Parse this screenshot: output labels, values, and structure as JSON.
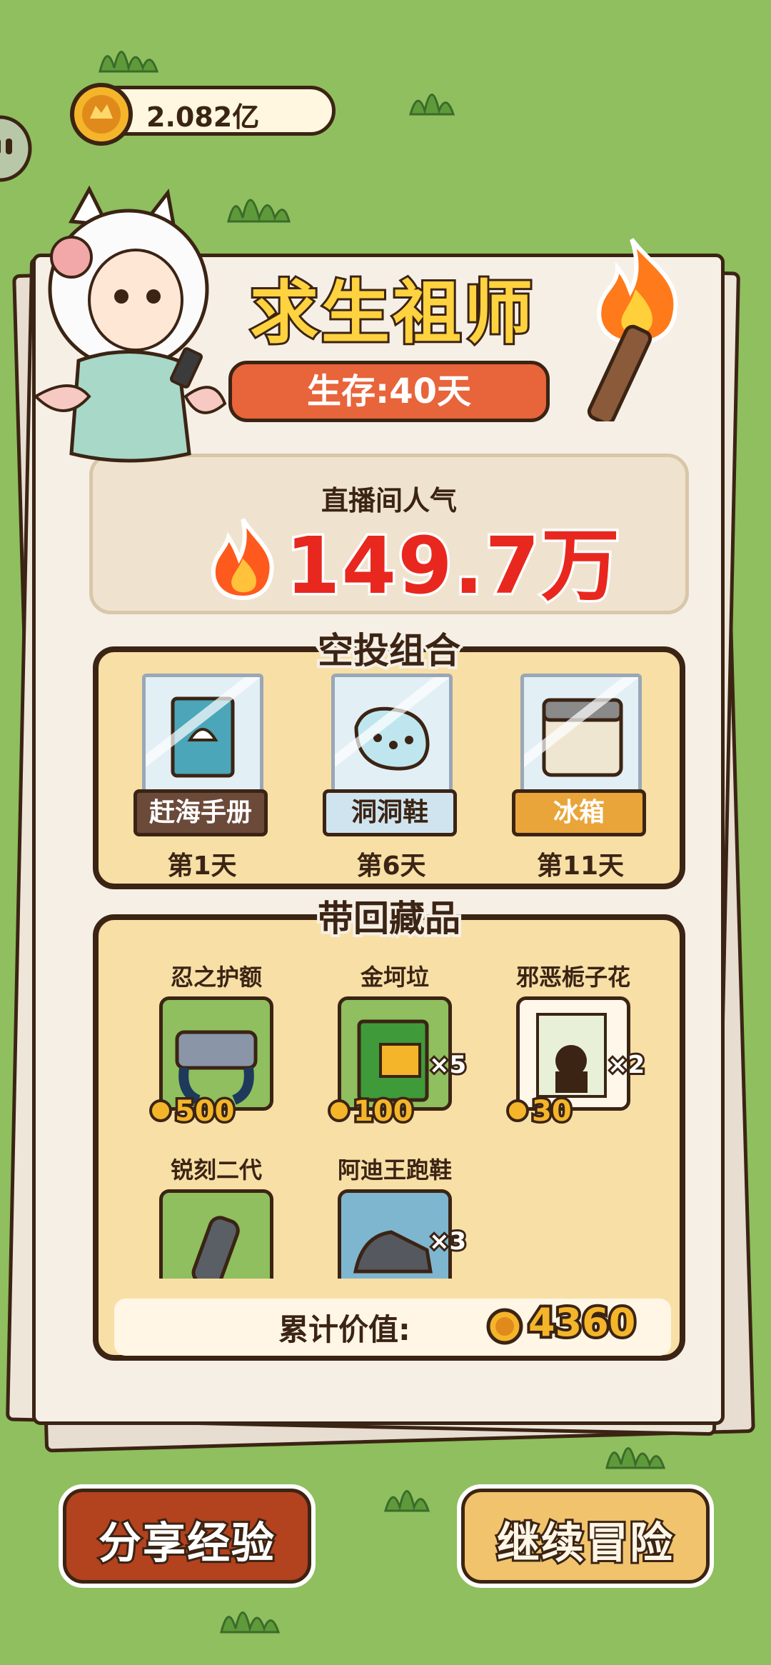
{
  "top_bar": {
    "coin_amount": "2.082亿"
  },
  "header": {
    "title": "求生祖师",
    "survival": "生存:40天"
  },
  "popularity": {
    "label": "直播间人气",
    "value": "149.7万"
  },
  "airdrop": {
    "title": "空投组合",
    "items": [
      {
        "name": "赶海手册",
        "day": "第1天",
        "tag_color": "#6b4a3a",
        "text_color": "#ffffff"
      },
      {
        "name": "洞洞鞋",
        "day": "第6天",
        "tag_color": "#cfe4ef",
        "text_color": "#3b2414"
      },
      {
        "name": "冰箱",
        "day": "第11天",
        "tag_color": "#e9a53a",
        "text_color": "#ffffff"
      }
    ]
  },
  "collectibles": {
    "title": "带回藏品",
    "items": [
      {
        "name": "忍之护额",
        "price": "500",
        "qty": ""
      },
      {
        "name": "金坷垃",
        "price": "100",
        "qty": "×5"
      },
      {
        "name": "邪恶栀子花",
        "price": "30",
        "qty": "×2"
      },
      {
        "name": "锐刻二代",
        "price": "",
        "qty": ""
      },
      {
        "name": "阿迪王跑鞋",
        "price": "",
        "qty": "×3"
      }
    ],
    "total_label": "累计价值:",
    "total_value": "4360"
  },
  "buttons": {
    "share": "分享经验",
    "continue": "继续冒险"
  },
  "colors": {
    "accent": "#e8643a",
    "gold": "#f4b52a",
    "outline": "#3b2414",
    "grass": "#8fbf5e"
  }
}
